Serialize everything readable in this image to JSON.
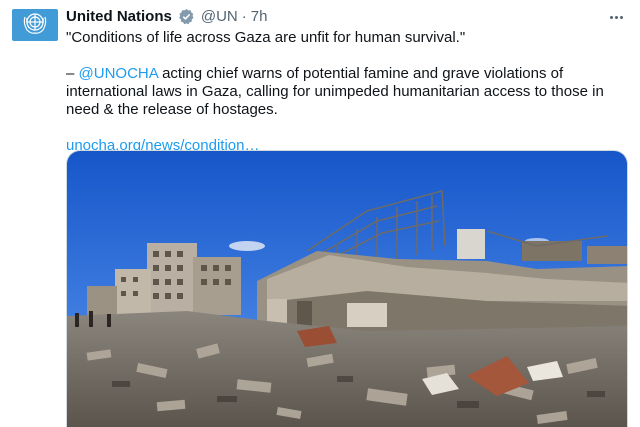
{
  "tweet": {
    "author_name": "United Nations",
    "handle": "@UN",
    "separator": "·",
    "time": "7h",
    "quote_line": "\"Conditions of life across Gaza are unfit for human survival.\"",
    "dash": "– ",
    "mention": "@UNOCHA",
    "body_rest": " acting chief warns of potential famine and grave violations of international laws in Gaza, calling for unimpeded humanitarian access to those in need & the release of hostages.",
    "link_text": "unocha.org/news/condition…"
  },
  "icons": {
    "avatar": "un-emblem-icon",
    "verified": "verified-badge-icon",
    "more": "more-options-icon"
  },
  "colors": {
    "accent": "#1d9bf0",
    "avatar_bg": "#419bd7",
    "verified_gold": "#e2b719",
    "secondary_text": "#536471"
  },
  "media": {
    "description": "photo-of-destroyed-buildings-and-rubble"
  }
}
